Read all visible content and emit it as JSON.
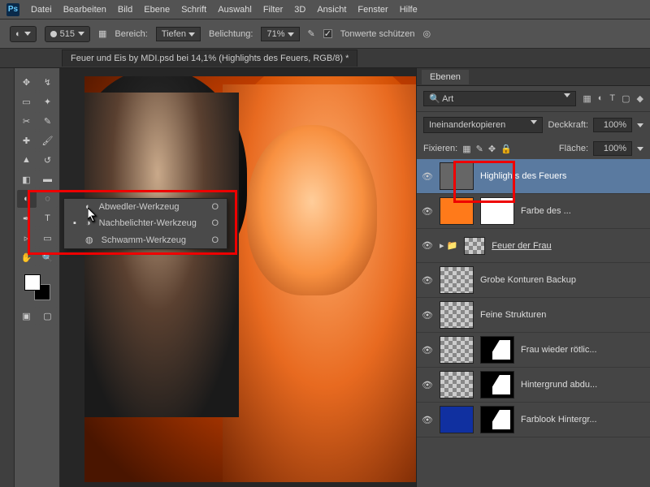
{
  "menu": {
    "items": [
      "Datei",
      "Bearbeiten",
      "Bild",
      "Ebene",
      "Schrift",
      "Auswahl",
      "Filter",
      "3D",
      "Ansicht",
      "Fenster",
      "Hilfe"
    ]
  },
  "options": {
    "brush_size": "515",
    "range_label": "Bereich:",
    "range_value": "Tiefen",
    "exposure_label": "Belichtung:",
    "exposure_value": "71%",
    "protect_label": "Tonwerte schützen"
  },
  "doc_tab": "Feuer und Eis by MDI.psd bei 14,1% (Highlights des Feuers, RGB/8) *",
  "flyout": {
    "items": [
      {
        "label": "Abwedler-Werkzeug",
        "key": "O"
      },
      {
        "label": "Nachbelichter-Werkzeug",
        "key": "O"
      },
      {
        "label": "Schwamm-Werkzeug",
        "key": "O"
      }
    ]
  },
  "panel": {
    "title": "Ebenen",
    "search": "Art",
    "blend_label": "Ineinanderkopieren",
    "opacity_label": "Deckkraft:",
    "opacity_value": "100%",
    "lock_label": "Fixieren:",
    "fill_label": "Fläche:",
    "fill_value": "100%"
  },
  "layers": [
    {
      "name": "Highlights des Feuers",
      "sel": true,
      "thumbs": [
        "gray"
      ]
    },
    {
      "name": "Farbe des ...",
      "thumbs": [
        "orange",
        "white"
      ]
    },
    {
      "name": "Feuer der Frau",
      "group": true,
      "underline": true
    },
    {
      "name": "Grobe Konturen Backup",
      "thumbs": [
        "checker"
      ]
    },
    {
      "name": "Feine Strukturen",
      "thumbs": [
        "checker"
      ]
    },
    {
      "name": "Frau wieder rötlic...",
      "thumbs": [
        "checker",
        "mask"
      ]
    },
    {
      "name": "Hintergrund abdu...",
      "thumbs": [
        "checker",
        "mask"
      ]
    },
    {
      "name": "Farblook Hintergr...",
      "thumbs": [
        "blue",
        "mask"
      ]
    }
  ]
}
